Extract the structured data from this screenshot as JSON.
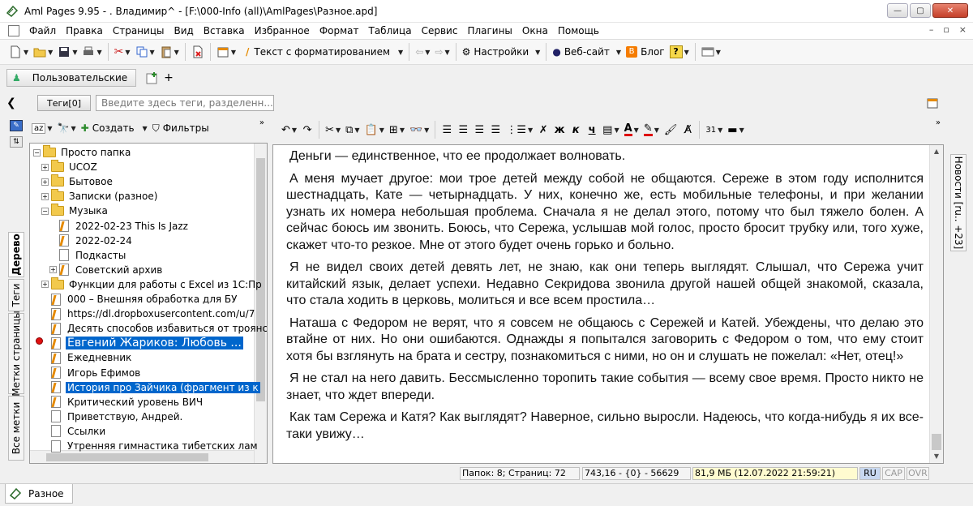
{
  "window": {
    "title": "Aml Pages 9.95 - .                   Владимир^ - [F:\\000-Info (all)\\AmlPages\\Разное.apd]",
    "controls": [
      "—",
      "▢",
      "✕"
    ]
  },
  "menu": {
    "items": [
      "Файл",
      "Правка",
      "Страницы",
      "Вид",
      "Вставка",
      "Избранное",
      "Формат",
      "Таблица",
      "Сервис",
      "Плагины",
      "Окна",
      "Помощь"
    ],
    "mdi": [
      "–",
      "▫",
      "×"
    ]
  },
  "toolbar": {
    "format_label": "Текст с форматированием",
    "settings_label": "Настройки",
    "website_label": "Веб-сайт",
    "blog_label": "Блог"
  },
  "tabs": {
    "custom_label": "Пользовательские",
    "plus": "+"
  },
  "tags": {
    "button_label": "Теги[0]",
    "input_placeholder": "Введите здесь теги, разделенн..."
  },
  "left_tabs": [
    "Дерево",
    "Теги",
    "Метки страницы",
    "Все метки"
  ],
  "tree_toolbar": {
    "create_label": "Создать",
    "filters_label": "Фильтры"
  },
  "tree": [
    {
      "label": "Просто папка",
      "type": "folder",
      "level": 0,
      "exp": "−"
    },
    {
      "label": "UCOZ",
      "type": "folder",
      "level": 1,
      "exp": "+"
    },
    {
      "label": "Бытовое",
      "type": "folder",
      "level": 1,
      "exp": "+"
    },
    {
      "label": "Записки (разное)",
      "type": "folder",
      "level": 1,
      "exp": "+"
    },
    {
      "label": "Музыка",
      "type": "folder",
      "level": 1,
      "exp": "−"
    },
    {
      "label": "2022-02-23 This Is Jazz",
      "type": "page-hl",
      "level": 2
    },
    {
      "label": "2022-02-24",
      "type": "page-hl",
      "level": 2
    },
    {
      "label": "Подкасты",
      "type": "page",
      "level": 2
    },
    {
      "label": "Советский архив",
      "type": "page-hl",
      "level": 2,
      "exp": "+"
    },
    {
      "label": "Функции для работы с Excel из 1С:Пр",
      "type": "folder",
      "level": 1,
      "exp": "+"
    },
    {
      "label": "000 – Внешняя обработка для БУ",
      "type": "page-hl",
      "level": 1
    },
    {
      "label": "https://dl.dropboxusercontent.com/u/7",
      "type": "page-hl",
      "level": 1
    },
    {
      "label": "Десять способов избавиться от троянс",
      "type": "page-hl",
      "level": 1
    },
    {
      "label": "Евгений Жариков: Любовь ...",
      "type": "page-hl",
      "level": 1,
      "selected": true,
      "big": true
    },
    {
      "label": "Ежедневник",
      "type": "page-hl",
      "level": 1
    },
    {
      "label": "Игорь Ефимов",
      "type": "page-hl",
      "level": 1
    },
    {
      "label": "История про Зайчика (фрагмент из к",
      "type": "page-hl",
      "level": 1,
      "selected": true
    },
    {
      "label": "Критический уровень ВИЧ",
      "type": "page-hl",
      "level": 1
    },
    {
      "label": "Приветствую, Андрей.",
      "type": "page",
      "level": 1
    },
    {
      "label": "Ссылки",
      "type": "page",
      "level": 1
    },
    {
      "label": "Утренняя гимнастика тибетских лам",
      "type": "page",
      "level": 1
    }
  ],
  "editor": {
    "paragraphs": [
      "Деньги — единственное, что ее продолжает волновать.",
      "А меня мучает другое: мои трое детей между собой не общаются. Сереже в этом году исполнится шестнадцать, Кате — четырнадцать. У них, конечно же, есть мобильные телефоны, и при желании узнать их номера небольшая проблема. Сначала я не делал этого, потому что был тяжело болен. А сейчас боюсь им звонить. Боюсь, что Сережа, услышав мой голос, просто бросит трубку или, того хуже, скажет что-то резкое. Мне от этого будет очень горько и больно.",
      "Я не видел своих детей девять лет, не знаю, как они теперь выглядят. Слышал, что Сережа учит китайский язык, делает успехи. Недавно Секридова звонила другой нашей общей знакомой, сказала, что стала ходить в церковь, молиться и все всем простила…",
      "Наташа с Федором не верят, что я совсем не общаюсь с Сережей и Катей. Убеждены, что делаю это втайне от них. Но они ошибаются. Однажды я попытался заговорить с Федором о том, что ему стоит хотя бы взглянуть на брата и сестру, познакомиться с ними, но он и слушать не пожелал: «Нет, отец!»",
      "Я не стал на него давить. Бессмысленно торопить такие события — всему свое время. Просто никто не знает, что ждет впереди.",
      "Как там Сережа и Катя? Как выглядят? Наверное, сильно выросли. Надеюсь, что когда-нибудь я их все-таки увижу…"
    ]
  },
  "news_tab": "Новости [ru.. +23]",
  "status": {
    "counts": "Папок: 8; Страниц: 72",
    "position": "743,16 - {0} - 56629",
    "memory": "81,9 МБ (12.07.2022 21:59:21)",
    "lang": "RU",
    "cap": "CAP",
    "ovr": "OVR"
  },
  "bottom_tab": "Разное",
  "colors": {
    "selection": "#0066cc",
    "memory_bg": "#fffbd0",
    "lang_bg": "#c8d8f0"
  }
}
